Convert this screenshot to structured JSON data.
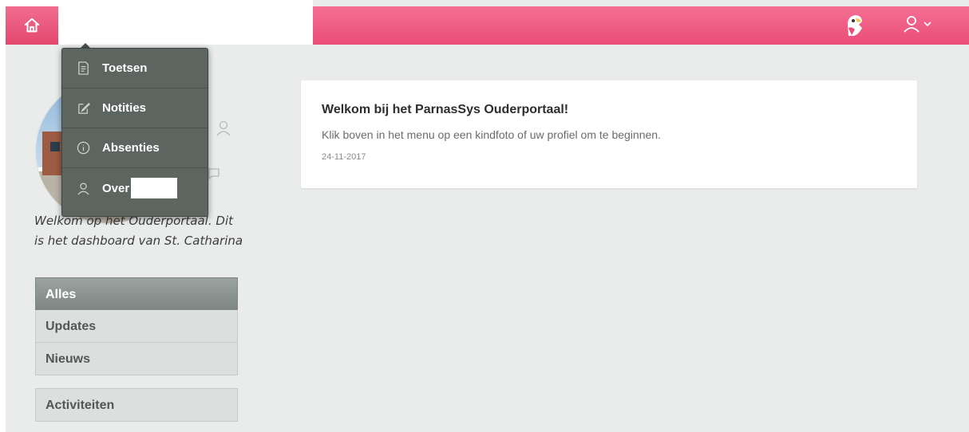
{
  "header": {
    "home_icon": "home-icon",
    "mascot_icon": "parrot-mascot-icon",
    "user_icon": "user-icon",
    "chevron_icon": "chevron-down-icon",
    "accent_color": "#ec5a80"
  },
  "menu": {
    "items": [
      {
        "label": "Toetsen",
        "icon": "document-icon"
      },
      {
        "label": "Notities",
        "icon": "edit-note-icon"
      },
      {
        "label": "Absenties",
        "icon": "info-icon"
      },
      {
        "label": "Over",
        "icon": "user-icon"
      }
    ]
  },
  "sidebar": {
    "welcome_text": "Welkom op het Ouderportaal. Dit is het dashboard van St. Catharina",
    "filters": [
      {
        "label": "Alles",
        "active": true
      },
      {
        "label": "Updates",
        "active": false
      },
      {
        "label": "Nieuws",
        "active": false
      }
    ],
    "activities_label": "Activiteiten"
  },
  "card": {
    "title": "Welkom bij het ParnasSys Ouderportaal!",
    "body": "Klik boven in het menu op een kindfoto of uw profiel om te beginnen.",
    "date": "24-11-2017"
  }
}
